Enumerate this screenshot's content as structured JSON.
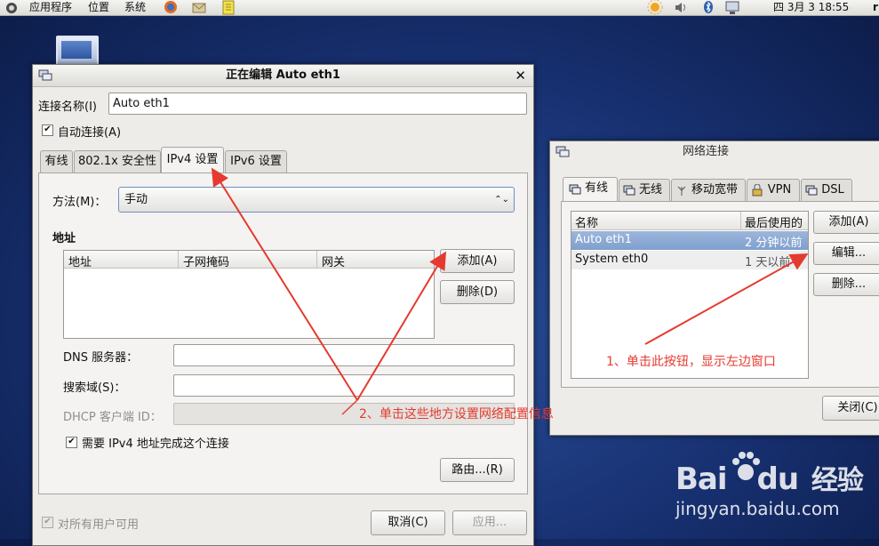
{
  "top_panel": {
    "menus": [
      "应用程序",
      "位置",
      "系统"
    ],
    "clock": "四 3月 3 18:55",
    "clip_letter": "r"
  },
  "edit_dialog": {
    "title": "正在编辑 Auto eth1",
    "conn_name_label": "连接名称(I)",
    "conn_name_value": "Auto eth1",
    "auto_connect_label": "自动连接(A)",
    "tabs": [
      "有线",
      "802.1x 安全性",
      "IPv4 设置",
      "IPv6 设置"
    ],
    "method_label": "方法(M)：",
    "method_value": "手动",
    "address_section": "地址",
    "address_columns": [
      "地址",
      "子网掩码",
      "网关"
    ],
    "add_button": "添加(A)",
    "delete_button": "删除(D)",
    "dns_label": "DNS 服务器：",
    "search_label": "搜索域(S)：",
    "dhcp_label": "DHCP 客户端 ID：",
    "require_ipv4_label": "需要 IPv4 地址完成这个连接",
    "routes_button": "路由...(R)",
    "all_users_label": "对所有用户可用",
    "cancel_button": "取消(C)",
    "apply_button": "应用..."
  },
  "net_dialog": {
    "title": "网络连接",
    "tabs": [
      "有线",
      "无线",
      "移动宽带",
      "VPN",
      "DSL"
    ],
    "columns": [
      "名称",
      "最后使用的"
    ],
    "rows": [
      {
        "name": "Auto eth1",
        "last": "2 分钟以前"
      },
      {
        "name": "System eth0",
        "last": "1 天以前"
      }
    ],
    "add_button": "添加(A)",
    "edit_button": "编辑...",
    "delete_button": "删除...",
    "close_button": "关闭(C)"
  },
  "annotations": {
    "step1": "1、单击此按钮，显示左边窗口",
    "step2": "2、单击这些地方设置网络配置信息",
    "arrow_color": "#e53a2f"
  },
  "watermark": {
    "brand": "Bai",
    "brand2": "du",
    "cn": "经验",
    "url": "jingyan.baidu.com"
  }
}
